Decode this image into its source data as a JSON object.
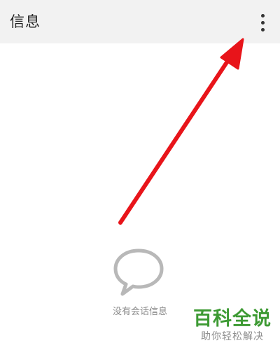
{
  "header": {
    "title": "信息",
    "menu_icon": "more-vertical-icon"
  },
  "annotation": {
    "type": "arrow",
    "color": "#e8141a",
    "points_to": "overflow-menu-button"
  },
  "empty_state": {
    "icon": "chat-bubble-icon",
    "message": "没有会话信息"
  },
  "watermark": {
    "title": "百科全说",
    "subtitle": "助你轻松解决"
  },
  "colors": {
    "appbar_bg": "#f2f2f2",
    "background": "#ffffff",
    "empty_text": "#8a8a8a",
    "watermark_green": "#3d9a33"
  }
}
